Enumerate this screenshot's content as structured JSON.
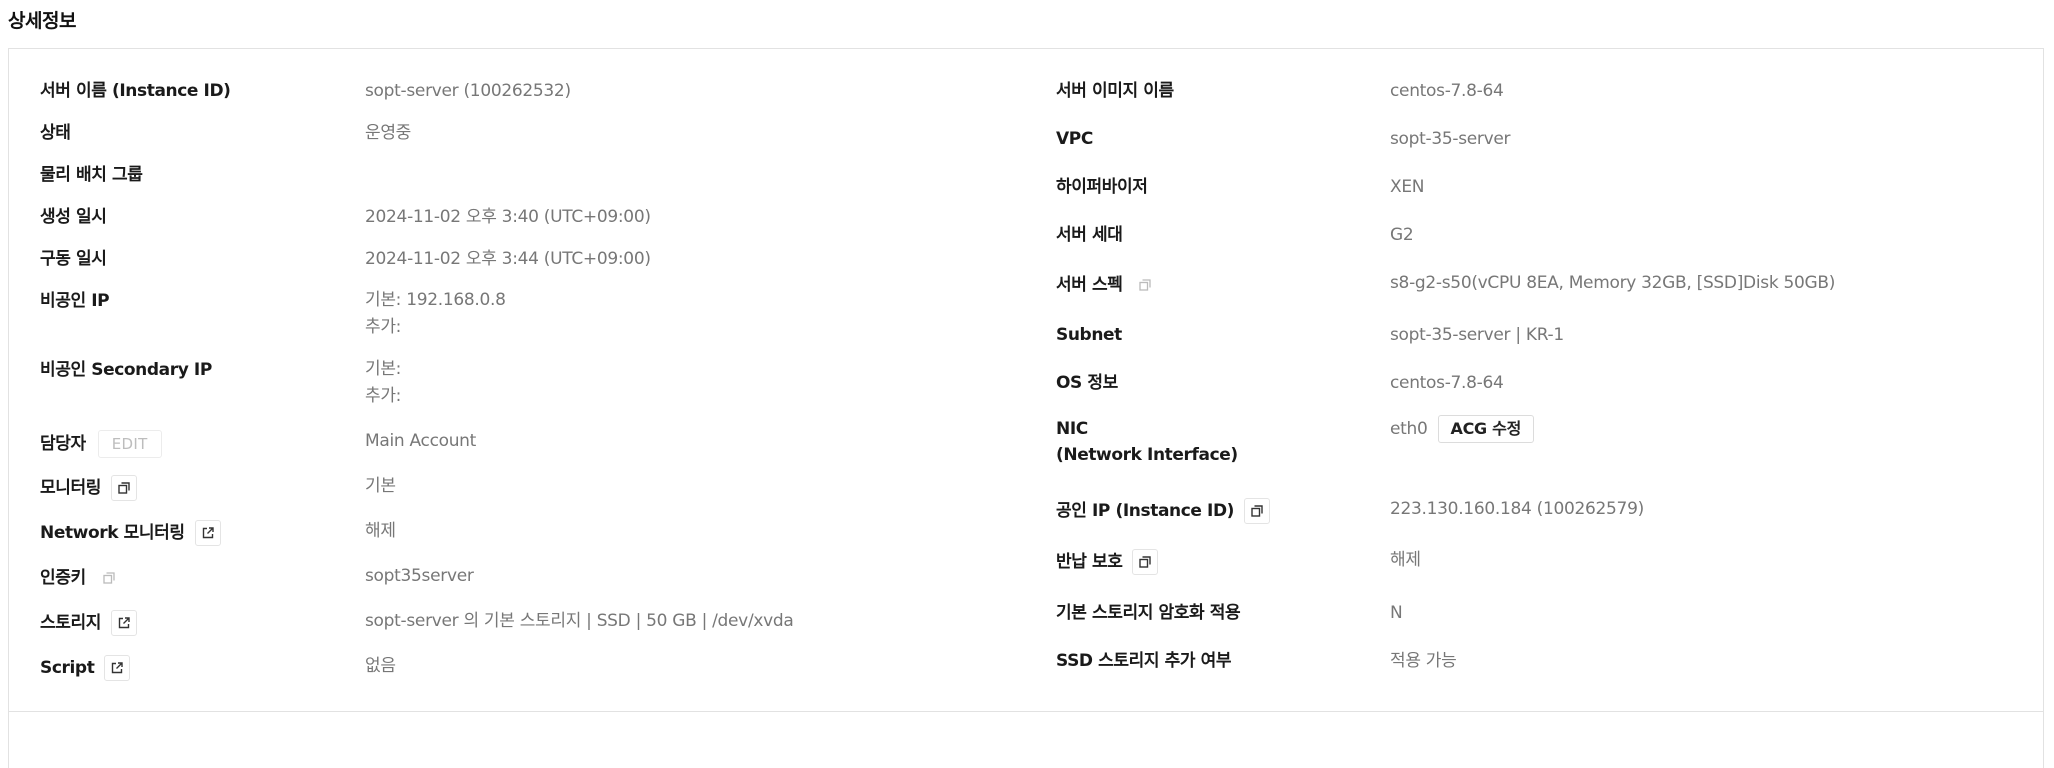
{
  "page": {
    "title": "상세정보"
  },
  "left": {
    "server_name": {
      "label": "서버 이름 (Instance ID)",
      "value": "sopt-server (100262532)"
    },
    "status": {
      "label": "상태",
      "value": "운영중"
    },
    "placement_group": {
      "label": "물리 배치 그룹",
      "value": ""
    },
    "created_at": {
      "label": "생성 일시",
      "value": "2024-11-02 오후 3:40 (UTC+09:00)"
    },
    "started_at": {
      "label": "구동 일시",
      "value": "2024-11-02 오후 3:44 (UTC+09:00)"
    },
    "private_ip": {
      "label": "비공인 IP",
      "value_line1": "기본: 192.168.0.8",
      "value_line2": "추가:"
    },
    "secondary_ip": {
      "label": "비공인 Secondary IP",
      "value_line1": "기본:",
      "value_line2": "추가:"
    },
    "manager": {
      "label": "담당자",
      "edit_label": "EDIT",
      "value": "Main Account"
    },
    "monitoring": {
      "label": "모니터링",
      "value": "기본",
      "icon": "popup-icon"
    },
    "network_monitoring": {
      "label": "Network 모니터링",
      "value": "해제",
      "icon": "external-link-icon"
    },
    "auth_key": {
      "label": "인증키",
      "value": "sopt35server",
      "icon": "popup-icon"
    },
    "storage": {
      "label": "스토리지",
      "value": "sopt-server 의 기본 스토리지 | SSD | 50 GB | /dev/xvda",
      "icon": "external-link-icon"
    },
    "script": {
      "label": "Script",
      "value": "없음",
      "icon": "external-link-icon"
    }
  },
  "right": {
    "image_name": {
      "label": "서버 이미지 이름",
      "value": "centos-7.8-64"
    },
    "vpc": {
      "label": "VPC",
      "value": "sopt-35-server"
    },
    "hypervisor": {
      "label": "하이퍼바이저",
      "value": "XEN"
    },
    "generation": {
      "label": "서버 세대",
      "value": "G2"
    },
    "spec": {
      "label": "서버 스펙",
      "value": "s8-g2-s50(vCPU 8EA, Memory 32GB, [SSD]Disk 50GB)",
      "icon": "popup-icon"
    },
    "subnet": {
      "label": "Subnet",
      "value": "sopt-35-server | KR-1"
    },
    "os_info": {
      "label": "OS 정보",
      "value": "centos-7.8-64"
    },
    "nic": {
      "label_line1": "NIC",
      "label_line2": "(Network Interface)",
      "value": "eth0",
      "acg_button": "ACG 수정"
    },
    "public_ip": {
      "label": "공인 IP (Instance ID)",
      "value": "223.130.160.184 (100262579)",
      "icon": "popup-icon"
    },
    "return_protection": {
      "label": "반납 보호",
      "value": "해제",
      "icon": "popup-icon"
    },
    "storage_encryption": {
      "label": "기본 스토리지 암호화 적용",
      "value": "N"
    },
    "ssd_add": {
      "label": "SSD 스토리지 추가 여부",
      "value": "적용 가능"
    }
  }
}
